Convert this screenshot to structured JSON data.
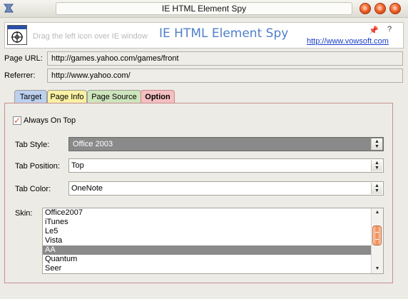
{
  "window": {
    "title": "IE HTML Element Spy"
  },
  "header": {
    "hint": "Drag the left icon over IE window",
    "app_title": "IE HTML Element Spy",
    "link": "http://www.vowsoft.com",
    "help": "?"
  },
  "rows": {
    "page_url_label": "Page URL:",
    "page_url_value": "http://games.yahoo.com/games/front",
    "referrer_label": "Referrer:",
    "referrer_value": "http://www.yahoo.com/"
  },
  "tabs": [
    "Target",
    "Page Info",
    "Page Source",
    "Option"
  ],
  "active_tab": "Option",
  "options": {
    "always_on_top_label": "Always On Top",
    "always_on_top_checked": true,
    "tab_style_label": "Tab Style:",
    "tab_style_value": "Office 2003",
    "tab_position_label": "Tab Position:",
    "tab_position_value": "Top",
    "tab_color_label": "Tab Color:",
    "tab_color_value": "OneNote",
    "skin_label": "Skin:",
    "skins": [
      "Office2007",
      "iTunes",
      "Le5",
      "Vista",
      "AA",
      "Quantum",
      "Seer"
    ],
    "selected_skin": "AA"
  },
  "colors": {
    "accent_title": "#4f7fc9",
    "tab_target": "#bcd0ef",
    "tab_info": "#faf1a4",
    "tab_source": "#cde5bd",
    "tab_option": "#f5bfc1"
  }
}
